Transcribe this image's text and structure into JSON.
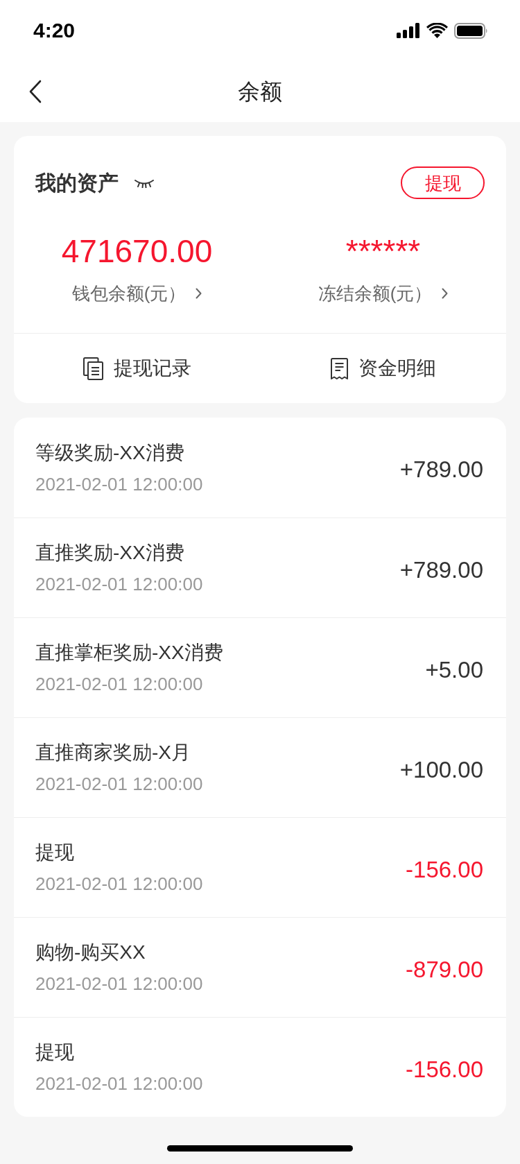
{
  "status_bar": {
    "time": "4:20"
  },
  "nav": {
    "title": "余额"
  },
  "assets": {
    "title": "我的资产",
    "withdraw_button": "提现",
    "balances": [
      {
        "amount": "471670.00",
        "label": "钱包余额(元）"
      },
      {
        "amount": "******",
        "label": "冻结余额(元）"
      }
    ],
    "links": [
      {
        "kind": "records",
        "label": "提现记录"
      },
      {
        "kind": "receipt",
        "label": "资金明细"
      }
    ]
  },
  "transactions": [
    {
      "title": "等级奖励-XX消费",
      "time": "2021-02-01 12:00:00",
      "amount": "+789.00",
      "kind": "income"
    },
    {
      "title": "直推奖励-XX消费",
      "time": "2021-02-01 12:00:00",
      "amount": "+789.00",
      "kind": "income"
    },
    {
      "title": "直推掌柜奖励-XX消费",
      "time": "2021-02-01 12:00:00",
      "amount": "+5.00",
      "kind": "income"
    },
    {
      "title": "直推商家奖励-X月",
      "time": "2021-02-01 12:00:00",
      "amount": "+100.00",
      "kind": "income"
    },
    {
      "title": "提现",
      "time": "2021-02-01 12:00:00",
      "amount": "-156.00",
      "kind": "expense"
    },
    {
      "title": "购物-购买XX",
      "time": "2021-02-01 12:00:00",
      "amount": "-879.00",
      "kind": "expense"
    },
    {
      "title": "提现",
      "time": "2021-02-01 12:00:00",
      "amount": "-156.00",
      "kind": "expense"
    }
  ]
}
